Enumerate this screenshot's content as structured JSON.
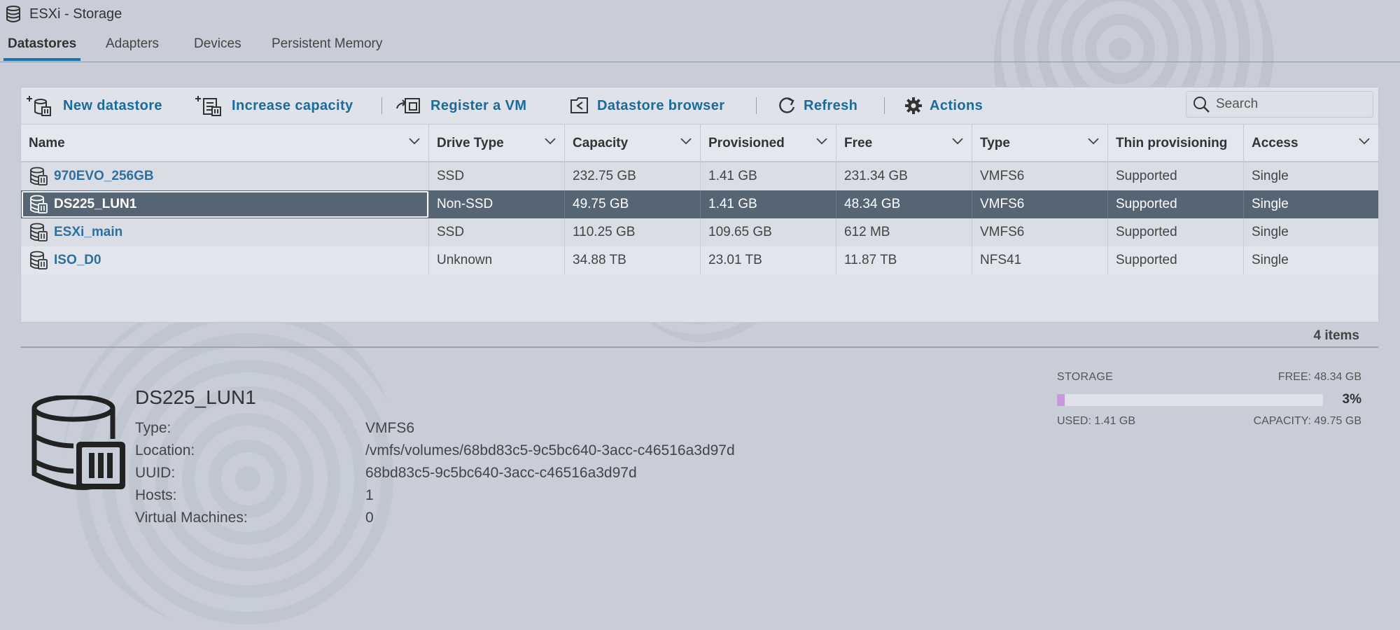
{
  "window": {
    "title": "ESXi - Storage",
    "icon": "database-icon"
  },
  "tabs": [
    {
      "label": "Datastores",
      "active": true
    },
    {
      "label": "Adapters",
      "active": false
    },
    {
      "label": "Devices",
      "active": false
    },
    {
      "label": "Persistent Memory",
      "active": false
    }
  ],
  "toolbar": {
    "new_datastore": "New datastore",
    "increase_capacity": "Increase capacity",
    "register_vm": "Register a VM",
    "datastore_browser": "Datastore browser",
    "refresh": "Refresh",
    "actions": "Actions",
    "search_placeholder": "Search"
  },
  "table": {
    "columns": [
      "Name",
      "Drive Type",
      "Capacity",
      "Provisioned",
      "Free",
      "Type",
      "Thin provisioning",
      "Access"
    ],
    "rows": [
      {
        "name": "970EVO_256GB",
        "drive_type": "SSD",
        "capacity": "232.75 GB",
        "provisioned": "1.41 GB",
        "free": "231.34 GB",
        "type": "VMFS6",
        "thin": "Supported",
        "access": "Single"
      },
      {
        "name": "DS225_LUN1",
        "drive_type": "Non-SSD",
        "capacity": "49.75 GB",
        "provisioned": "1.41 GB",
        "free": "48.34 GB",
        "type": "VMFS6",
        "thin": "Supported",
        "access": "Single"
      },
      {
        "name": "ESXi_main",
        "drive_type": "SSD",
        "capacity": "110.25 GB",
        "provisioned": "109.65 GB",
        "free": "612 MB",
        "type": "VMFS6",
        "thin": "Supported",
        "access": "Single"
      },
      {
        "name": "ISO_D0",
        "drive_type": "Unknown",
        "capacity": "34.88 TB",
        "provisioned": "23.01 TB",
        "free": "11.87 TB",
        "type": "NFS41",
        "thin": "Supported",
        "access": "Single"
      }
    ],
    "selected_index": 1,
    "item_count": "4 items"
  },
  "details": {
    "name": "DS225_LUN1",
    "labels": [
      "Type:",
      "Location:",
      "UUID:",
      "Hosts:",
      "Virtual Machines:"
    ],
    "values": [
      "VMFS6",
      "/vmfs/volumes/68bd83c5-9c5bc640-3acc-c46516a3d97d",
      "68bd83c5-9c5bc640-3acc-c46516a3d97d",
      "1",
      "0"
    ]
  },
  "storage_meter": {
    "label": "STORAGE",
    "free": "FREE: 48.34 GB",
    "percent": "3%",
    "used_fraction": 0.03,
    "used": "USED: 1.41 GB",
    "capacity": "CAPACITY: 49.75 GB",
    "fill_color": "#c39ad8"
  },
  "colors": {
    "accent": "#1a70b0",
    "link": "#2f6f9f",
    "selected_row": "#566574"
  }
}
